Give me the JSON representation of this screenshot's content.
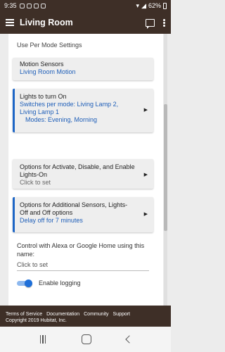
{
  "status_bar": {
    "time": "9:35",
    "battery": "62%"
  },
  "app_bar": {
    "title": "Living Room"
  },
  "section_label": "Use Per Mode Settings",
  "cards": [
    {
      "header": "Motion Sensors",
      "value": "Living Room Motion"
    },
    {
      "header": "Lights to turn On",
      "value_line1": "Switches per mode: Living Lamp 2,",
      "value_line2": "Living Lamp 1",
      "value_line3": "Modes: Evening, Morning",
      "arrow": "▶"
    },
    {
      "header_line1": "Options for Activate, Disable, and Enable",
      "header_line2": "Lights-On",
      "sub": "Click to set",
      "arrow": "▶"
    },
    {
      "header_line1": "Options for Additional Sensors, Lights-",
      "header_line2": "Off and Off options",
      "value": "Delay off for 7 minutes",
      "arrow": "▶"
    }
  ],
  "alexa": {
    "label": "Control with Alexa or Google Home using this name:",
    "value": "Click to set"
  },
  "logging": {
    "label": "Enable logging",
    "enabled": true
  },
  "footer": {
    "links": [
      "Terms of Service",
      "Documentation",
      "Community",
      "Support"
    ],
    "copyright": "Copyright 2019 Hubitat, Inc."
  },
  "colors": {
    "bar": "#3e2f27",
    "accent": "#1e66c6",
    "value_text": "#1e5eb8"
  }
}
